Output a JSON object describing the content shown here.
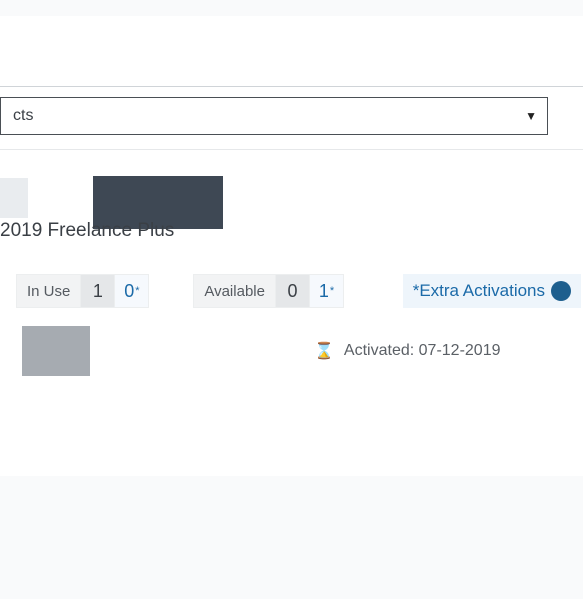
{
  "dropdown": {
    "visible_text": "cts"
  },
  "product": {
    "title": "2019 Freelance Plus"
  },
  "stats": {
    "in_use": {
      "label": "In Use",
      "count": "1",
      "extra": "0"
    },
    "available": {
      "label": "Available",
      "count": "0",
      "extra": "1"
    },
    "extra_label": "*Extra Activations"
  },
  "activation": {
    "label": "Activated:",
    "date": "07-12-2019",
    "icon_glyph": "⌛"
  }
}
